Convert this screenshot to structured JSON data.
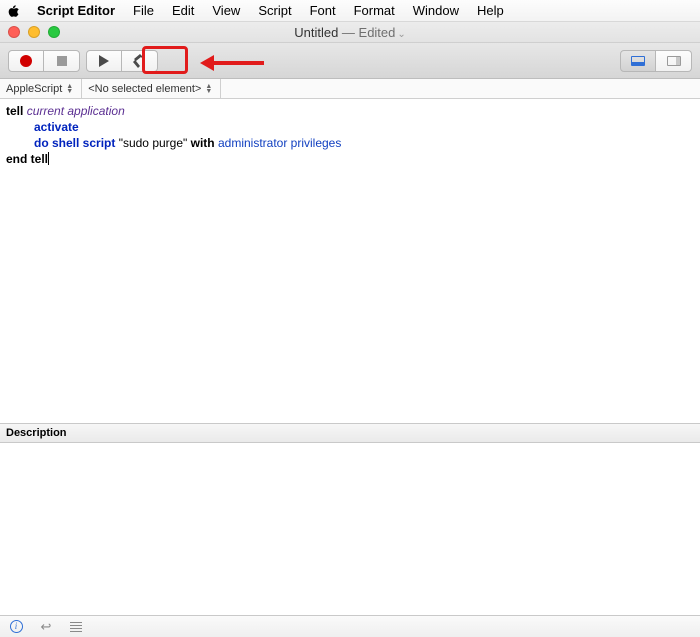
{
  "menubar": {
    "app": "Script Editor",
    "items": [
      "File",
      "Edit",
      "View",
      "Script",
      "Font",
      "Format",
      "Window",
      "Help"
    ]
  },
  "window": {
    "title_primary": "Untitled",
    "title_secondary": " — Edited"
  },
  "subbar": {
    "language": "AppleScript",
    "element": "<No selected element>"
  },
  "code": {
    "l1_tell": "tell",
    "l1_app": "current application",
    "l2_activate": "activate",
    "l3_do": "do shell script",
    "l3_str": "\"sudo purge\"",
    "l3_with": "with",
    "l3_priv": "administrator privileges",
    "l4_end": "end tell"
  },
  "desc": {
    "header": "Description"
  },
  "icons": {
    "apple": "apple-logo-icon",
    "record": "record-icon",
    "stop": "stop-icon",
    "run": "run-icon",
    "compile": "compile-hammer-icon",
    "panel_bottom": "bottom-panel-icon",
    "panel_side": "side-panel-icon",
    "info": "info-icon",
    "return": "return-icon",
    "log": "log-lines-icon"
  }
}
